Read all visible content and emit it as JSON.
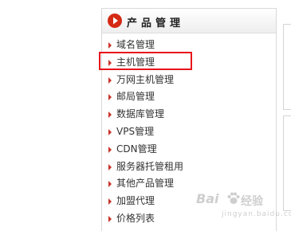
{
  "panel": {
    "title": "产品管理",
    "menu_items": [
      {
        "label": "域名管理"
      },
      {
        "label": "主机管理"
      },
      {
        "label": "万网主机管理"
      },
      {
        "label": "邮局管理"
      },
      {
        "label": "数据库管理"
      },
      {
        "label": "VPS管理"
      },
      {
        "label": "CDN管理"
      },
      {
        "label": "服务器托管租用"
      },
      {
        "label": "其他产品管理"
      },
      {
        "label": "加盟代理"
      },
      {
        "label": "价格列表"
      }
    ],
    "highlighted_item": "主机管理"
  },
  "watermark": {
    "brand": "Bai",
    "brand_suffix": "经验",
    "url": "jingyan.baidu.com"
  },
  "colors": {
    "accent_red": "#d42a14",
    "highlight_red": "#e8141c",
    "arrow": "#c9342a",
    "text": "#333333",
    "border": "#d9d9d9"
  },
  "icons": {
    "header": "play-circle-icon",
    "item_bullet": "triangle-right-icon",
    "watermark": "paw-icon"
  }
}
